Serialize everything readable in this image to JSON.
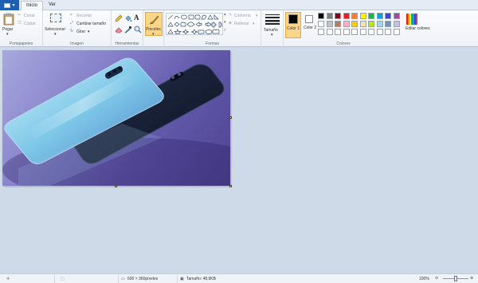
{
  "tabs": {
    "file_label": "",
    "home": "Inicio",
    "view": "Ver"
  },
  "clipboard": {
    "paste": "Pegar",
    "cut": "Cortar",
    "copy": "Copiar",
    "group": "Portapapeles"
  },
  "image": {
    "select": "Seleccionar",
    "crop": "Recortar",
    "resize": "Cambiar tamaño",
    "rotate": "Girar",
    "group": "Imagen"
  },
  "tools": {
    "group": "Herramientas",
    "text_glyph": "A"
  },
  "brushes": {
    "label": "Pinceles"
  },
  "shapes": {
    "outline": "Contorno",
    "fill": "Rellenar",
    "group": "Formas"
  },
  "size": {
    "label": "Tamaño"
  },
  "colors": {
    "color1_label": "Color 1",
    "color2_label": "Color 2",
    "edit_label": "Editar colores",
    "group": "Colores",
    "color1": "#000000",
    "color2": "#ffffff",
    "palette_row1": [
      "#000000",
      "#7f7f7f",
      "#880015",
      "#ed1c24",
      "#ff7f27",
      "#fff200",
      "#22b14c",
      "#00a2e8",
      "#3f48cc",
      "#a349a4"
    ],
    "palette_row2": [
      "#ffffff",
      "#c3c3c3",
      "#b97a57",
      "#ffaec9",
      "#ffc90e",
      "#efe4b0",
      "#b5e61d",
      "#99d9ea",
      "#7092be",
      "#c8bfe7"
    ],
    "palette_row3": [
      "#ffffff",
      "#ffffff",
      "#ffffff",
      "#ffffff",
      "#ffffff",
      "#ffffff",
      "#ffffff",
      "#ffffff",
      "#ffffff",
      "#ffffff"
    ]
  },
  "status": {
    "dimensions": "600 × 360píxeles",
    "size": "Tamaño: 48,9KB",
    "zoom": "100%"
  },
  "icons": [
    "file-menu-icon",
    "paste-icon",
    "cut-icon",
    "copy-icon",
    "select-icon",
    "crop-icon",
    "resize-icon",
    "rotate-icon",
    "pencil-icon",
    "fill-icon",
    "text-icon",
    "eraser-icon",
    "color-picker-icon",
    "magnifier-icon",
    "brush-icon",
    "shapes-gallery-icon",
    "outline-icon",
    "fill-shape-icon",
    "size-icon",
    "edit-colors-icon",
    "cursor-position-icon",
    "selection-size-icon",
    "image-dimensions-icon",
    "file-size-icon",
    "zoom-slider-icon"
  ]
}
